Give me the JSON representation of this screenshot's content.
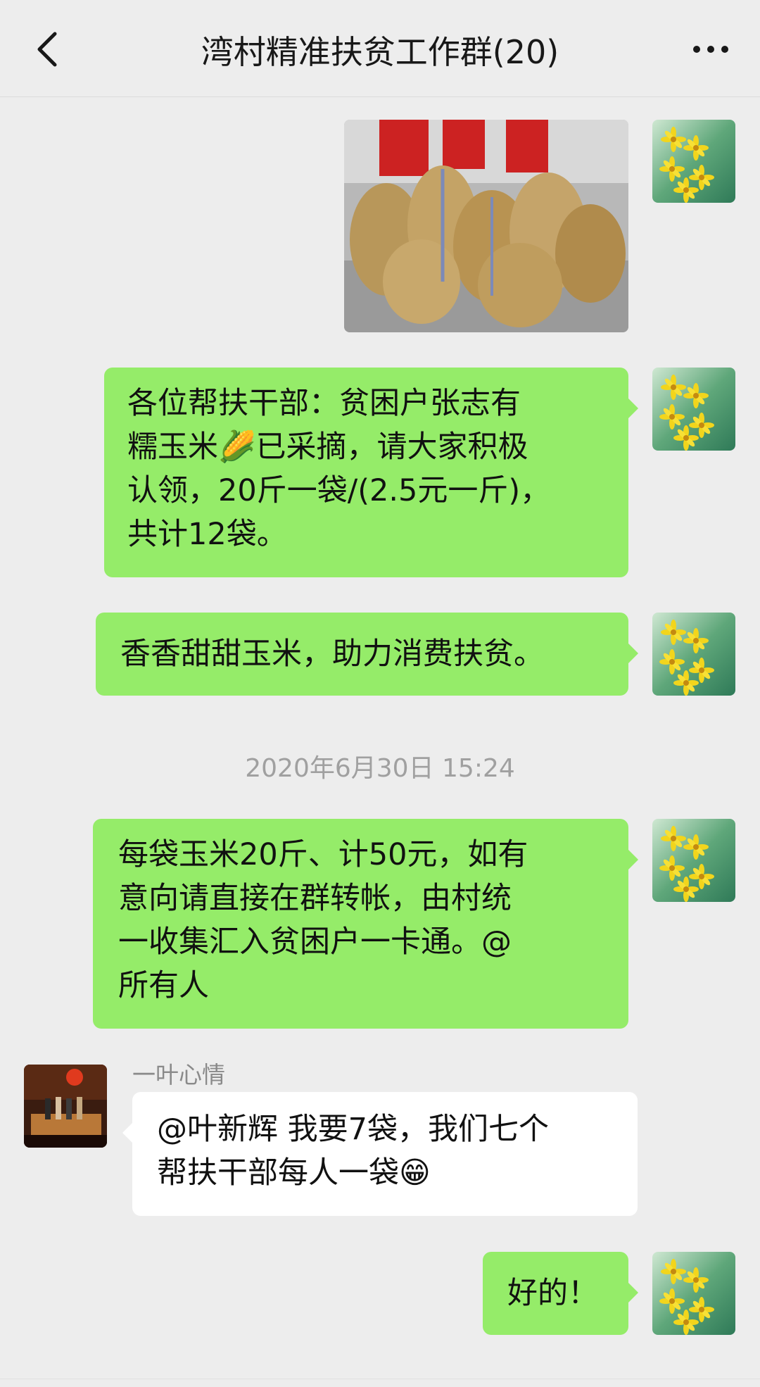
{
  "header": {
    "title": "湾村精准扶贫工作群(20)"
  },
  "icons": {
    "back": "chevron-left-icon",
    "more": "more-dots-icon"
  },
  "messages": [
    {
      "from": "me",
      "type": "image",
      "content": "photo of bagged corn"
    },
    {
      "from": "me",
      "type": "text",
      "lines": [
        "各位帮扶干部：贫困户张志有",
        "糯玉米🌽已采摘，请大家积极",
        "认领，20斤一袋/(2.5元一斤)，",
        "共计12袋。"
      ]
    },
    {
      "from": "me",
      "type": "text",
      "lines": [
        "香香甜甜玉米，助力消费扶贫。"
      ]
    },
    {
      "from": "me",
      "type": "text",
      "lines": [
        "每袋玉米20斤、计50元，如有",
        "意向请直接在群转帐，由村统",
        "一收集汇入贫困户一卡通。@",
        "所有人"
      ]
    },
    {
      "from": "other",
      "sender": "一叶心情",
      "type": "text",
      "lines": [
        "@叶新辉 我要7袋，我们七个",
        "帮扶干部每人一袋😁"
      ]
    },
    {
      "from": "me",
      "type": "text",
      "lines": [
        "好的！"
      ]
    }
  ],
  "timestamp": "2020年6月30日 15:24",
  "colors": {
    "background": "#ededed",
    "my_bubble": "#95ec69",
    "other_bubble": "#ffffff"
  }
}
